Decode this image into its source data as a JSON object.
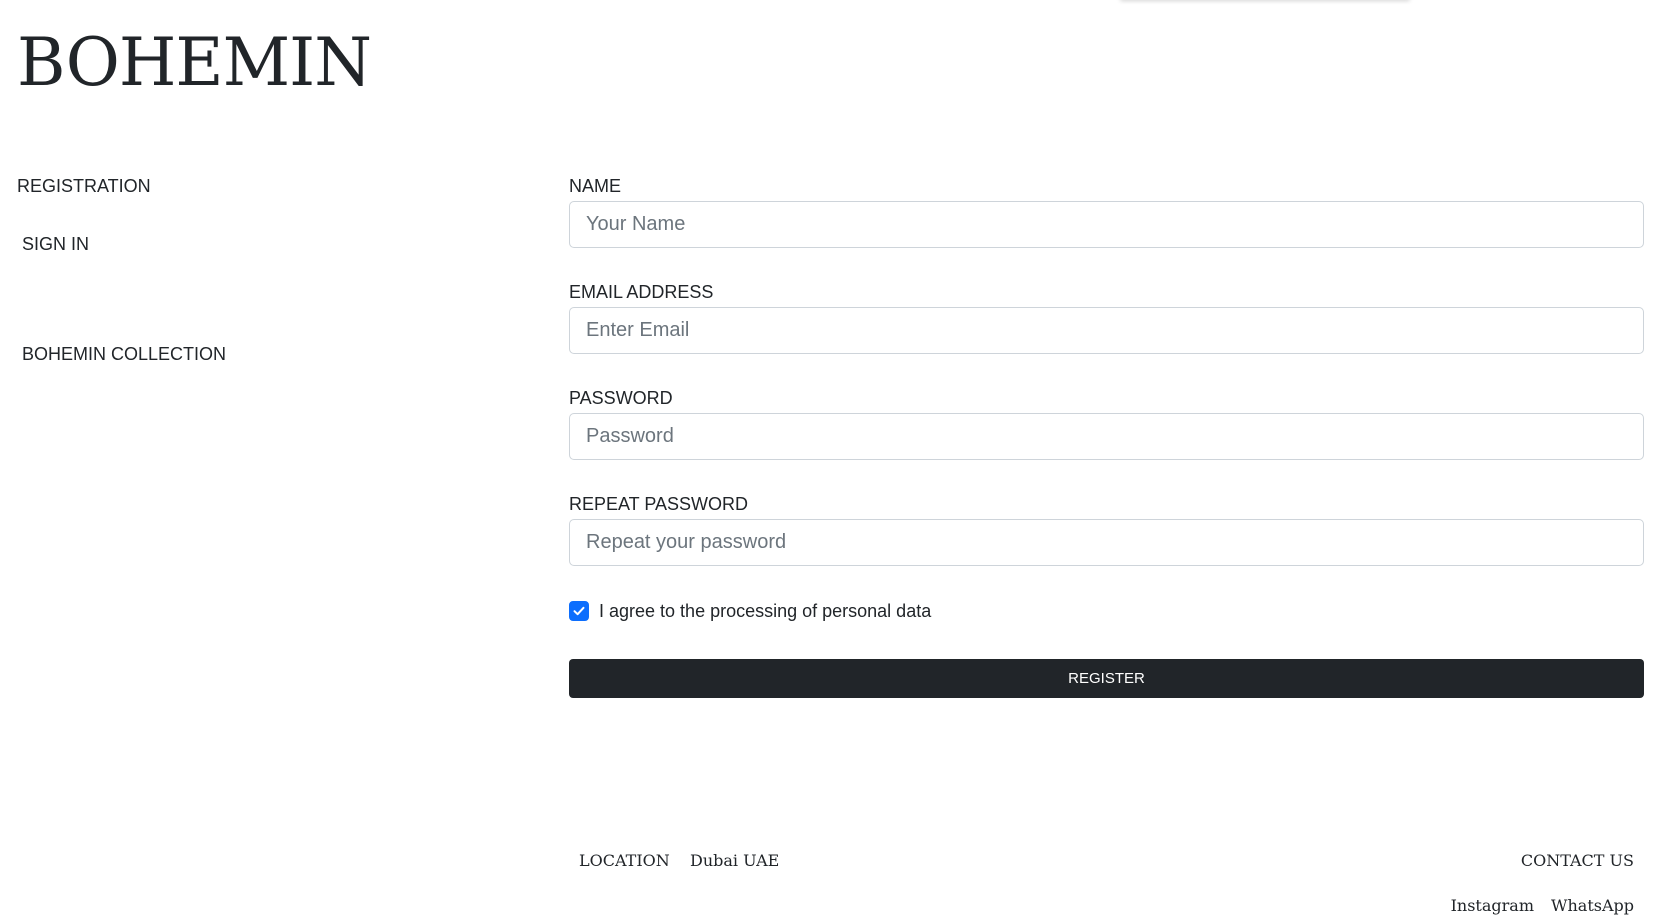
{
  "brand": {
    "name": "BOHEMIN"
  },
  "side_nav": {
    "registration": "REGISTRATION",
    "sign_in": "SIGN IN",
    "collection": "BOHEMIN COLLECTION"
  },
  "form": {
    "name": {
      "label": "NAME",
      "placeholder": "Your Name",
      "value": ""
    },
    "email": {
      "label": "EMAIL ADDRESS",
      "placeholder": "Enter Email",
      "value": ""
    },
    "password": {
      "label": "PASSWORD",
      "placeholder": "Password",
      "value": ""
    },
    "repeat_password": {
      "label": "REPEAT PASSWORD",
      "placeholder": "Repeat your password",
      "value": ""
    },
    "agree": {
      "label": "I agree to the processing of personal data",
      "checked": true
    },
    "submit_label": "REGISTER"
  },
  "footer": {
    "location_label": "LOCATION",
    "location_value": "Dubai UAE",
    "contact_label": "CONTACT US",
    "instagram": "Instagram",
    "whatsapp": "WhatsApp"
  },
  "colors": {
    "text": "#212529",
    "button_bg": "#212529",
    "checkbox_accent": "#0d6efd",
    "input_border": "#ced4da",
    "placeholder": "#6c757d"
  },
  "icons": {
    "checkbox": "check-icon"
  }
}
